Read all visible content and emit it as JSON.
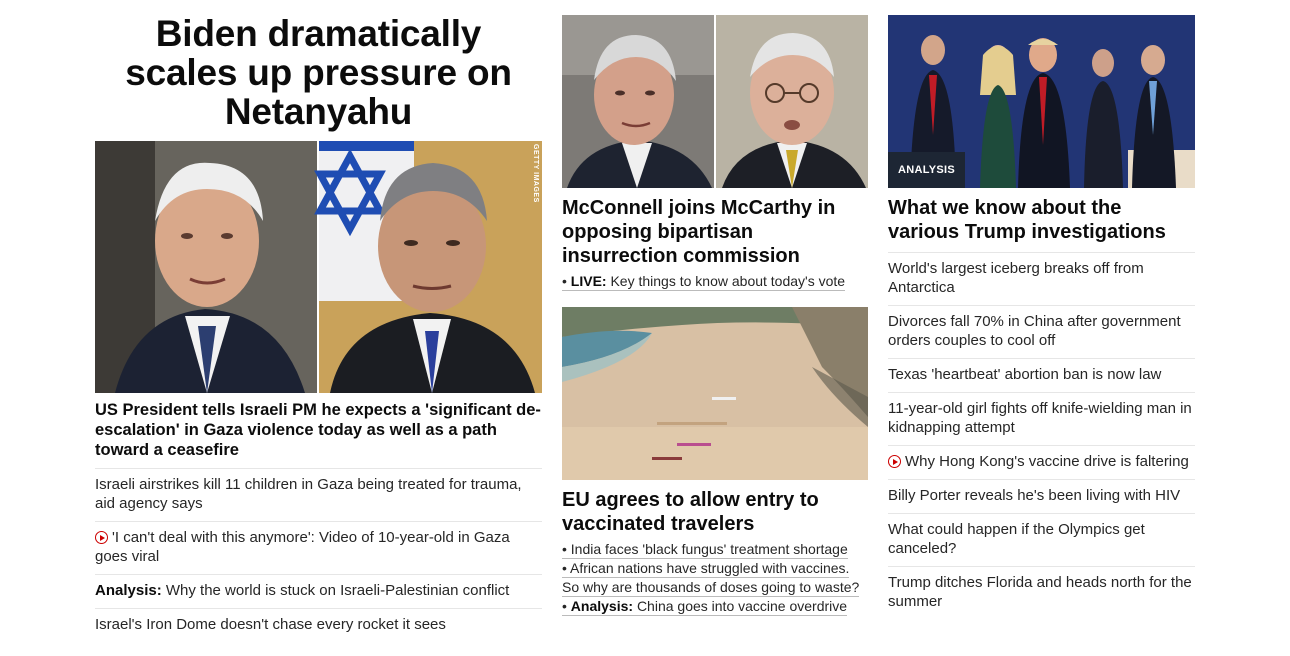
{
  "main_story": {
    "headline": "Biden dramatically scales up pressure on Netanyahu",
    "image_credit": "GETTY IMAGES",
    "summary": "US President tells Israeli PM he expects a 'significant de-escalation' in Gaza violence today as well as a path toward a ceasefire",
    "related": [
      {
        "prefix": "",
        "has_video": false,
        "text": "Israeli airstrikes kill 11 children in Gaza being treated for trauma, aid agency says"
      },
      {
        "prefix": "",
        "has_video": true,
        "text": "'I can't deal with this anymore': Video of 10-year-old in Gaza goes viral"
      },
      {
        "prefix": "Analysis:",
        "has_video": false,
        "text": "Why the world is stuck on Israeli-Palestinian conflict"
      },
      {
        "prefix": "",
        "has_video": false,
        "text": "Israel's Iron Dome doesn't chase every rocket it sees"
      }
    ]
  },
  "mid_story_1": {
    "headline": "McConnell joins McCarthy in opposing bipartisan insurrection commission",
    "bullets": [
      {
        "prefix": "LIVE:",
        "text": "Key things to know about today's vote"
      }
    ]
  },
  "mid_story_2": {
    "headline": "EU agrees to allow entry to vaccinated travelers",
    "bullets": [
      {
        "prefix": "",
        "text": "India faces 'black fungus' treatment shortage"
      },
      {
        "prefix": "",
        "text": "African nations have struggled with vaccines. So why are thousands of doses going to waste?"
      },
      {
        "prefix": "Analysis:",
        "text": "China goes into vaccine overdrive"
      }
    ]
  },
  "right_story": {
    "badge": "ANALYSIS",
    "headline": "What we know about the various Trump investigations",
    "list": [
      {
        "has_video": false,
        "text": "World's largest iceberg breaks off from Antarctica"
      },
      {
        "has_video": false,
        "text": "Divorces fall 70% in China after government orders couples to cool off"
      },
      {
        "has_video": false,
        "text": "Texas 'heartbeat' abortion ban is now law"
      },
      {
        "has_video": false,
        "text": "11-year-old girl fights off knife-wielding man in kidnapping attempt"
      },
      {
        "has_video": true,
        "text": "Why Hong Kong's vaccine drive is faltering"
      },
      {
        "has_video": false,
        "text": "Billy Porter reveals he's been living with HIV"
      },
      {
        "has_video": false,
        "text": "What could happen if the Olympics get canceled?"
      },
      {
        "has_video": false,
        "text": "Trump ditches Florida and heads north for the summer"
      }
    ]
  },
  "colors": {
    "video_icon": "#cc0000",
    "badge_bg": "#1d2634",
    "divider": "#e6e6e6"
  }
}
